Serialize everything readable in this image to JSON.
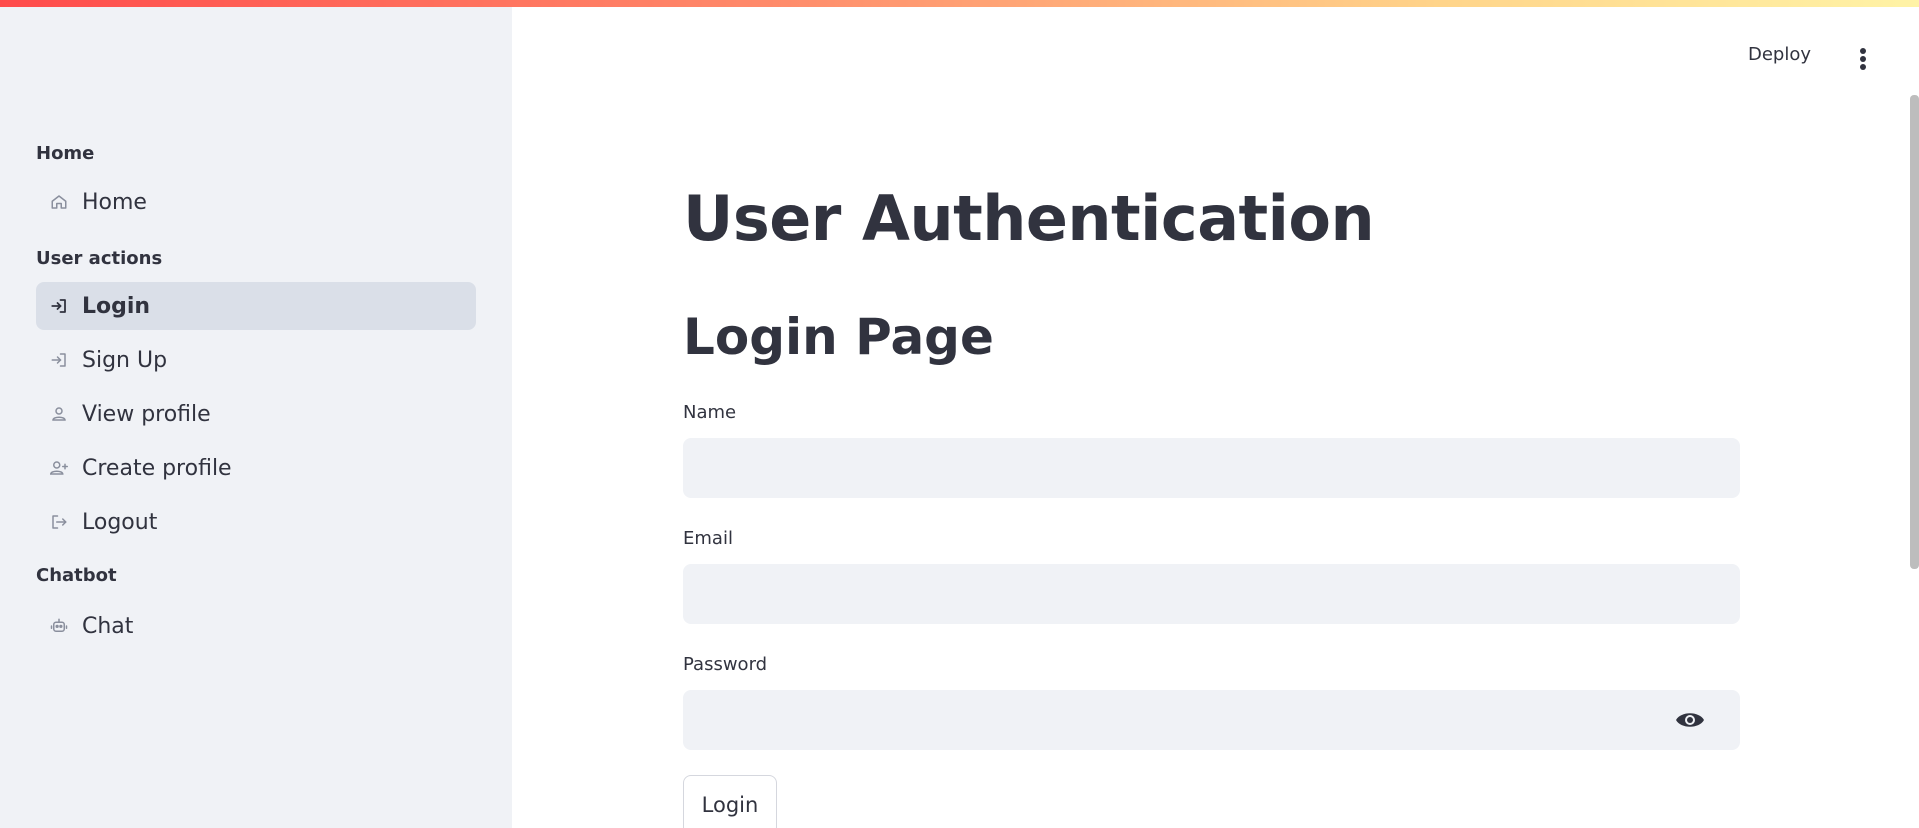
{
  "topbar": {
    "deploy_label": "Deploy",
    "menu_icon": "kebab-vertical-icon"
  },
  "sidebar": {
    "sections": [
      {
        "label": "Home"
      },
      {
        "label": "User actions"
      },
      {
        "label": "Chatbot"
      }
    ],
    "items": [
      {
        "label": "Home",
        "icon": "home-icon",
        "active": false
      },
      {
        "label": "Login",
        "icon": "login-icon",
        "active": true
      },
      {
        "label": "Sign Up",
        "icon": "login-icon",
        "active": false
      },
      {
        "label": "View profile",
        "icon": "person-icon",
        "active": false
      },
      {
        "label": "Create profile",
        "icon": "person-add-icon",
        "active": false
      },
      {
        "label": "Logout",
        "icon": "logout-icon",
        "active": false
      },
      {
        "label": "Chat",
        "icon": "robot-icon",
        "active": false
      }
    ]
  },
  "main": {
    "title": "User Authentication",
    "subtitle": "Login Page",
    "form": {
      "name_label": "Name",
      "name_value": "",
      "email_label": "Email",
      "email_value": "",
      "password_label": "Password",
      "password_value": "",
      "submit_label": "Login"
    }
  },
  "colors": {
    "sidebar_bg": "#f0f2f6",
    "active_item_bg": "#dadfe8",
    "text": "#31333f",
    "input_bg": "#f0f2f6",
    "accent": "#ff4b4b"
  }
}
